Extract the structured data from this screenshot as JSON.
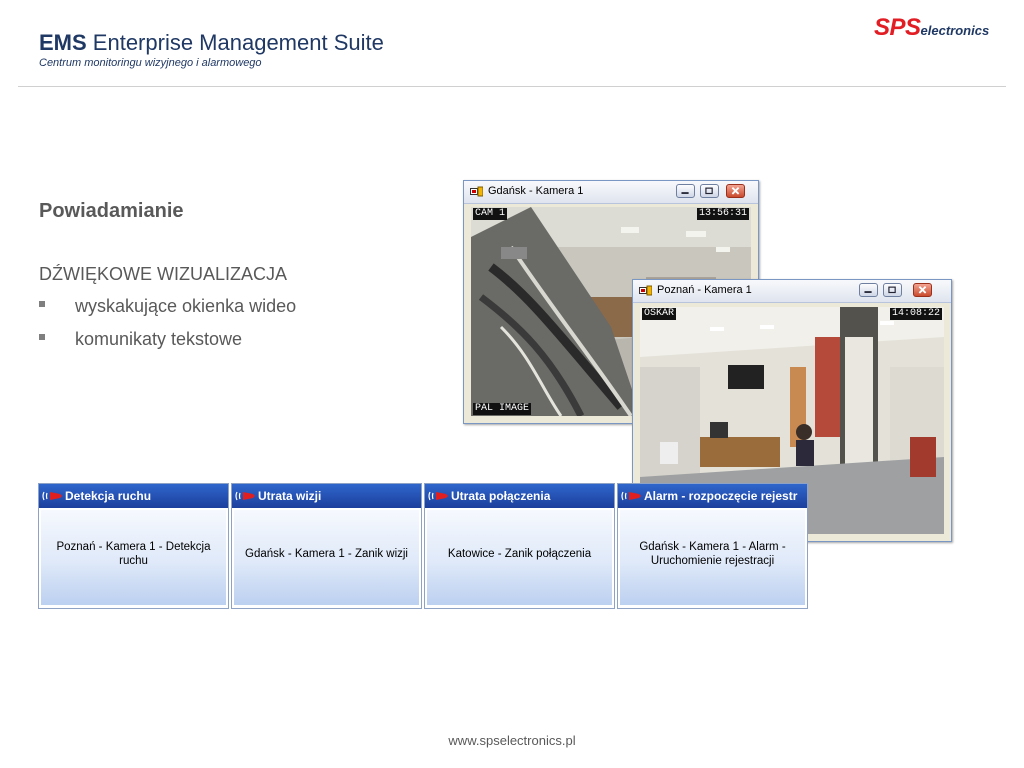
{
  "header": {
    "title_bold": "EMS",
    "title_rest": " Enterprise Management Suite",
    "subtitle": "Centrum monitoringu wizyjnego i alarmowego",
    "logo_main": "SPS",
    "logo_sub": "electronics",
    "brand_red": "#e21d24",
    "brand_navy": "#1f3864"
  },
  "content": {
    "heading": "Powiadamianie",
    "category": "DŹWIĘKOWE WIZUALIZACJA",
    "bullets": [
      "wyskakujące okienka wideo",
      "komunikaty tekstowe"
    ]
  },
  "windows": [
    {
      "title": "Gdańsk - Kamera 1",
      "osd_top_left": "CAM 1",
      "osd_top_right": "13:56:31",
      "osd_bottom_left": "PAL IMAGE"
    },
    {
      "title": "Poznań - Kamera 1",
      "osd_top_left": "OSKAR",
      "osd_top_right": "14:08:22"
    }
  ],
  "alerts": [
    {
      "title": "Detekcja ruchu",
      "message": "Poznań - Kamera 1 - Detekcja ruchu"
    },
    {
      "title": "Utrata wizji",
      "message": "Gdańsk - Kamera 1 - Zanik wizji"
    },
    {
      "title": "Utrata połączenia",
      "message": "Katowice - Zanik połączenia"
    },
    {
      "title": "Alarm - rozpoczęcie rejestr",
      "message": "Gdańsk - Kamera 1 - Alarm - Uruchomienie rejestracji"
    }
  ],
  "footer": {
    "url": "www.spselectronics.pl"
  },
  "icons": {
    "window_app": "camera-window-icon",
    "minimize": "minimize-icon",
    "maximize": "maximize-icon",
    "close": "close-icon",
    "alert": "alarm-siren-icon",
    "bullet": "square-bullet-icon"
  }
}
